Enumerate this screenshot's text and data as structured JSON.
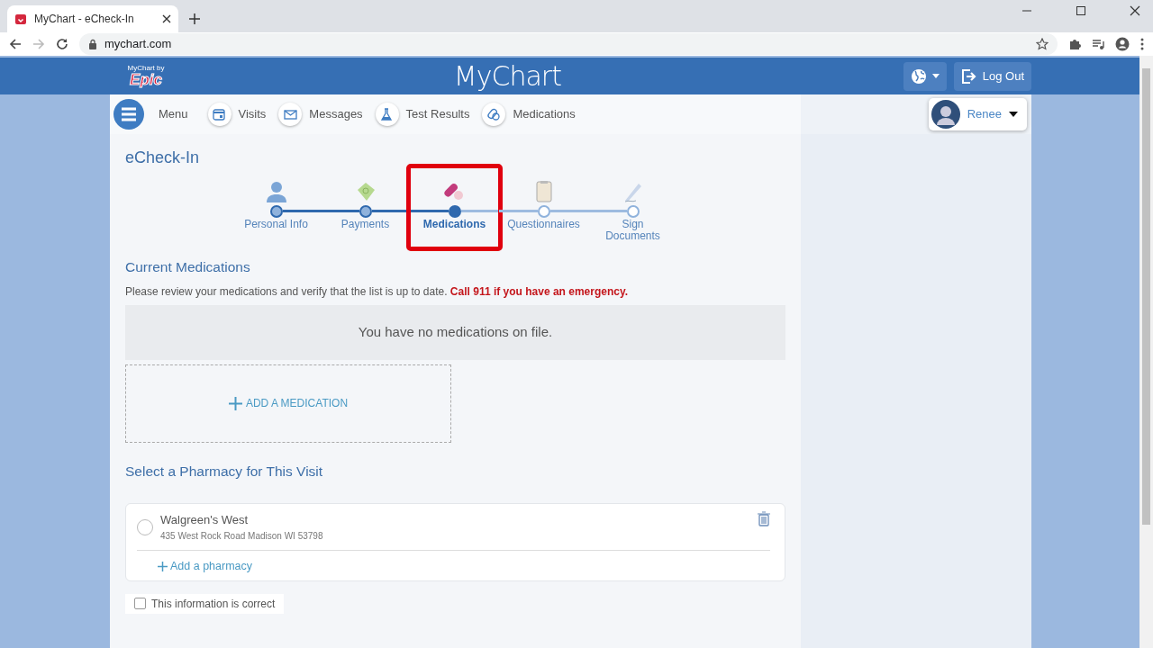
{
  "browser": {
    "tab_title": "MyChart - eCheck-In",
    "url": "mychart.com"
  },
  "header": {
    "logo_small": "MyChart by",
    "logo_brand": "Epic",
    "title": "MyChart",
    "logout": "Log Out"
  },
  "nav": {
    "menu": "Menu",
    "items": [
      {
        "label": "Visits"
      },
      {
        "label": "Messages"
      },
      {
        "label": "Test Results"
      },
      {
        "label": "Medications"
      }
    ],
    "user": "Renee"
  },
  "page": {
    "title": "eCheck-In",
    "steps": [
      {
        "label": "Personal Info",
        "completed": true,
        "selected": false,
        "highlighted": false
      },
      {
        "label": "Payments",
        "completed": true,
        "selected": false,
        "highlighted": false
      },
      {
        "label": "Medications",
        "completed": false,
        "selected": true,
        "highlighted": true
      },
      {
        "label": "Questionnaires",
        "completed": false,
        "selected": false,
        "highlighted": false
      },
      {
        "label": "Sign Documents",
        "completed": false,
        "selected": false,
        "highlighted": false
      }
    ],
    "medications": {
      "heading": "Current Medications",
      "intro": "Please review your medications and verify that the list is up to date. **Call 911 if you have an emergency.**",
      "empty": "You have no medications on file.",
      "add": "ADD A MEDICATION"
    },
    "pharmacy": {
      "heading": "Select a Pharmacy for This Visit",
      "options": [
        {
          "name": "Walgreen's West",
          "address": "435 West Rock Road Madison WI 53798",
          "selected": false
        }
      ],
      "add": "Add a pharmacy"
    },
    "confirm": {
      "label": "This information is correct",
      "checked": false
    }
  }
}
